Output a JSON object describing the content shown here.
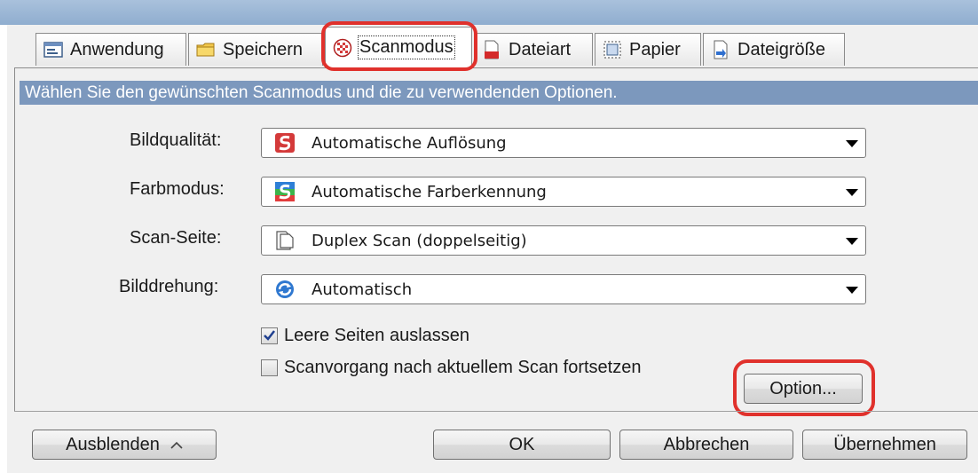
{
  "tabs": [
    {
      "label": "Anwendung",
      "icon": "application-icon"
    },
    {
      "label": "Speichern",
      "icon": "folder-icon"
    },
    {
      "label": "Scanmodus",
      "icon": "scanmode-icon",
      "active": true
    },
    {
      "label": "Dateiart",
      "icon": "file-type-icon"
    },
    {
      "label": "Papier",
      "icon": "paper-icon"
    },
    {
      "label": "Dateigröße",
      "icon": "file-size-icon"
    }
  ],
  "banner": "Wählen Sie den gewünschten Scanmodus und die zu verwendenden Optionen.",
  "settings": [
    {
      "label": "Bildqualität:",
      "value": "Automatische Auflösung",
      "icon": "scansnap-red-icon"
    },
    {
      "label": "Farbmodus:",
      "value": "Automatische Farberkennung",
      "icon": "scansnap-color-icon"
    },
    {
      "label": "Scan-Seite:",
      "value": "Duplex Scan (doppelseitig)",
      "icon": "duplex-page-icon"
    },
    {
      "label": "Bilddrehung:",
      "value": "Automatisch",
      "icon": "rotate-icon"
    }
  ],
  "checkboxes": [
    {
      "label": "Leere Seiten auslassen",
      "checked": true
    },
    {
      "label": "Scanvorgang nach aktuellem Scan fortsetzen",
      "checked": false
    }
  ],
  "buttons": {
    "option": "Option...",
    "hide": "Ausblenden",
    "ok": "OK",
    "cancel": "Abbrechen",
    "apply": "Übernehmen"
  },
  "colors": {
    "highlight": "#e0312c",
    "banner": "#7c98bd",
    "titlebar": "#a9c1dc"
  }
}
